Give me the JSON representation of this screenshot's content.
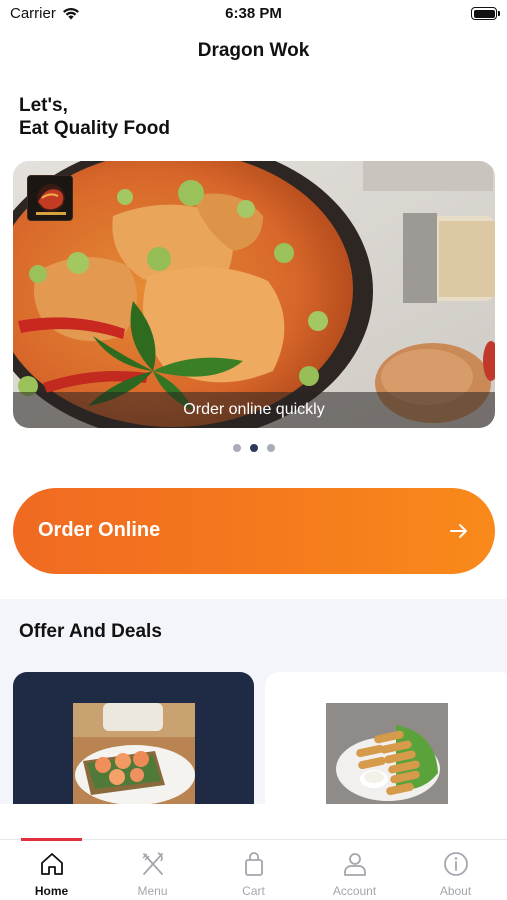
{
  "status_bar": {
    "carrier": "Carrier",
    "time": "6:38 PM"
  },
  "nav": {
    "title": "Dragon Wok"
  },
  "greeting": {
    "line1": "Let's,",
    "line2": "Eat Quality Food"
  },
  "carousel": {
    "caption": "Order online quickly",
    "slide_count": 3,
    "active_index": 1
  },
  "order_button": {
    "label": "Order Online",
    "icon": "arrow-right-icon"
  },
  "offers": {
    "title": "Offer And Deals"
  },
  "tab_bar": {
    "items": [
      {
        "label": "Home",
        "icon": "home-icon",
        "active": true
      },
      {
        "label": "Menu",
        "icon": "fork-knife-icon",
        "active": false
      },
      {
        "label": "Cart",
        "icon": "shopping-bag-icon",
        "active": false
      },
      {
        "label": "Account",
        "icon": "user-icon",
        "active": false
      },
      {
        "label": "About",
        "icon": "info-icon",
        "active": false
      }
    ]
  },
  "colors": {
    "accent_orange": "#f57a1d",
    "tab_indicator": "#e2303f",
    "navy_card": "#1f2a44",
    "section_bg": "#f3f5fa"
  }
}
